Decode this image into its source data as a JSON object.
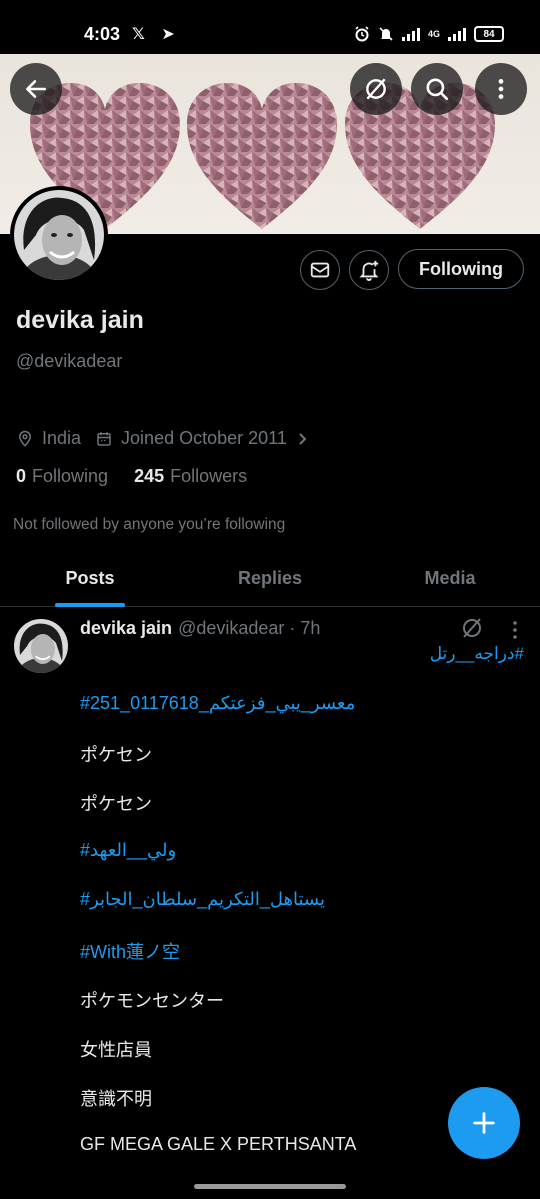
{
  "status_bar": {
    "time": "4:03",
    "app_icons": "𝕏 ➤",
    "network": "4G",
    "battery": "84"
  },
  "header": {
    "back_icon": "arrow-left-icon",
    "grok_icon": "grok-icon",
    "search_icon": "search-icon",
    "more_icon": "more-vertical-icon"
  },
  "profile": {
    "display_name": "devika jain",
    "handle": "@devikadear",
    "location": "India",
    "joined": "Joined October 2011",
    "following_count": "0",
    "following_label": "Following",
    "followers_count": "245",
    "followers_label": "Followers",
    "not_followed": "Not followed by anyone you’re following",
    "follow_button": "Following"
  },
  "tabs": [
    {
      "label": "Posts",
      "active": true
    },
    {
      "label": "Replies",
      "active": false
    },
    {
      "label": "Media",
      "active": false
    }
  ],
  "post": {
    "author": "devika jain",
    "meta": "@devikadear · 7h",
    "side_hashtag": "#دراجه__رتل",
    "lines": [
      {
        "text": "#251_معسر_يبي_فزعتكم_0117618",
        "link": true
      },
      {
        "text": "ポケセン",
        "link": false
      },
      {
        "text": "ポケセン",
        "link": false
      },
      {
        "text": "#ولي__العهد",
        "link": true
      },
      {
        "text": "#يستاهل_التكريم_سلطان_الجابر",
        "link": true
      },
      {
        "text": "#With蓮ノ空",
        "link": true
      },
      {
        "text": "ポケモンセンター",
        "link": false
      },
      {
        "text": "女性店員",
        "link": false
      },
      {
        "text": "意識不明",
        "link": false
      },
      {
        "text": "GF MEGA GALE X PERTHSANTA",
        "link": false
      }
    ]
  },
  "colors": {
    "accent": "#1d9bf0",
    "muted": "#71767b",
    "text": "#e7e9ea",
    "background": "#000000"
  }
}
